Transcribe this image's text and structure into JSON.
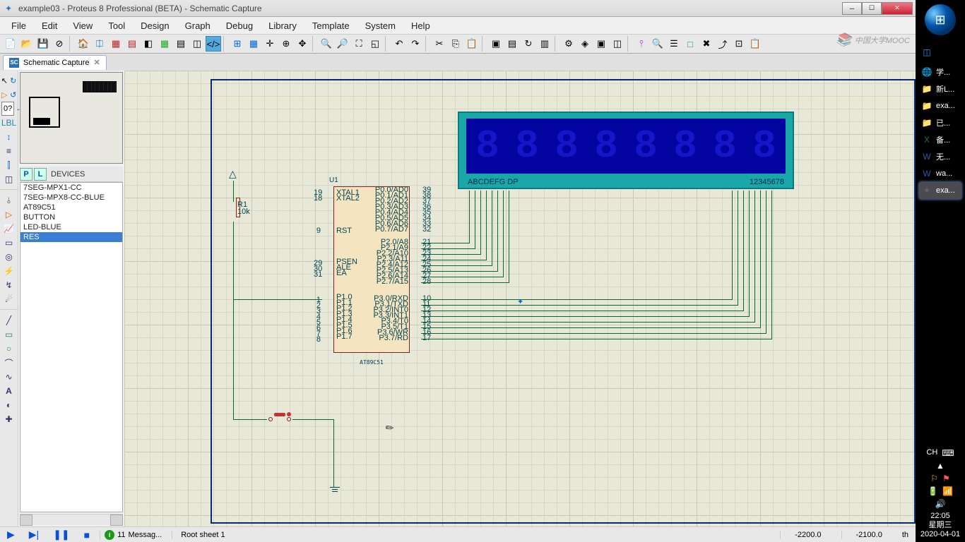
{
  "title": "example03 - Proteus 8 Professional (BETA) - Schematic Capture",
  "menu": [
    "File",
    "Edit",
    "View",
    "Tool",
    "Design",
    "Graph",
    "Debug",
    "Library",
    "Template",
    "System",
    "Help"
  ],
  "tab": {
    "label": "Schematic Capture"
  },
  "zoom_input": "0?",
  "devices": {
    "header": "DEVICES",
    "buttons": [
      "P",
      "L"
    ],
    "items": [
      "7SEG-MPX1-CC",
      "7SEG-MPX8-CC-BLUE",
      "AT89C51",
      "BUTTON",
      "LED-BLUE",
      "RES"
    ],
    "selected": "RES"
  },
  "mcu": {
    "ref": "U1",
    "name": "AT89C51",
    "left_pins_1": [
      "19",
      "18"
    ],
    "left_lbl_1": [
      "XTAL1",
      "XTAL2"
    ],
    "left_pins_2": [
      "9"
    ],
    "left_lbl_2": [
      "RST"
    ],
    "left_pins_3": [
      "29",
      "30",
      "31"
    ],
    "left_lbl_3": [
      "PSEN",
      "ALE",
      "EA"
    ],
    "left_pins_4": [
      "1",
      "2",
      "3",
      "4",
      "5",
      "6",
      "7",
      "8"
    ],
    "left_lbl_4": [
      "P1.0",
      "P1.1",
      "P1.2",
      "P1.3",
      "P1.4",
      "P1.5",
      "P1.6",
      "P1.7"
    ],
    "right_pins_1": [
      "39",
      "38",
      "37",
      "36",
      "35",
      "34",
      "33",
      "32"
    ],
    "right_lbl_1": [
      "P0.0/AD0",
      "P0.1/AD1",
      "P0.2/AD2",
      "P0.3/AD3",
      "P0.4/AD4",
      "P0.5/AD5",
      "P0.6/AD6",
      "P0.7/AD7"
    ],
    "right_pins_2": [
      "21",
      "22",
      "23",
      "24",
      "25",
      "26",
      "27",
      "28"
    ],
    "right_lbl_2": [
      "P2.0/A8",
      "P2.1/A9",
      "P2.2/A10",
      "P2.3/A11",
      "P2.4/A12",
      "P2.5/A13",
      "P2.6/A14",
      "P2.7/A15"
    ],
    "right_pins_3": [
      "10",
      "11",
      "12",
      "13",
      "14",
      "15",
      "16",
      "17"
    ],
    "right_lbl_3": [
      "P3.0/RXD",
      "P3.1/TXD",
      "P3.2/INT0",
      "P3.3/INT1",
      "P3.4/T0",
      "P3.5/T1",
      "P3.6/WR",
      "P3.7/RD"
    ]
  },
  "resistor": {
    "ref": "R1",
    "value": "10k"
  },
  "display_labels": {
    "left": "ABCDEFG DP",
    "right": "12345678"
  },
  "status": {
    "messages_count": "11",
    "messages_label": "Messag...",
    "sheet": "Root sheet 1",
    "coord_x": "-2200.0",
    "coord_y": "-2100.0",
    "unit": "th"
  },
  "sidebar": {
    "items": [
      {
        "icon": "◫",
        "label": "",
        "color": "#27a0e8"
      },
      {
        "icon": "🌐",
        "label": "学...",
        "color": "#e84c30",
        "active": false
      },
      {
        "icon": "📁",
        "label": "新L...",
        "color": "#e8c26a"
      },
      {
        "icon": "📁",
        "label": "exa...",
        "color": "#e8c26a"
      },
      {
        "icon": "📁",
        "label": "已...",
        "color": "#e8c26a"
      },
      {
        "icon": "X",
        "label": "备...",
        "color": "#1a7a3a"
      },
      {
        "icon": "W",
        "label": "无...",
        "color": "#2a5aaa"
      },
      {
        "icon": "W",
        "label": "wa...",
        "color": "#2a5aaa"
      },
      {
        "icon": "✦",
        "label": "exa...",
        "color": "#666",
        "active": true
      }
    ],
    "clock": {
      "time": "22:05",
      "weekday": "星期三",
      "date": "2020-04-01"
    },
    "lang": "CH"
  },
  "watermark": "中国大学MOOC"
}
